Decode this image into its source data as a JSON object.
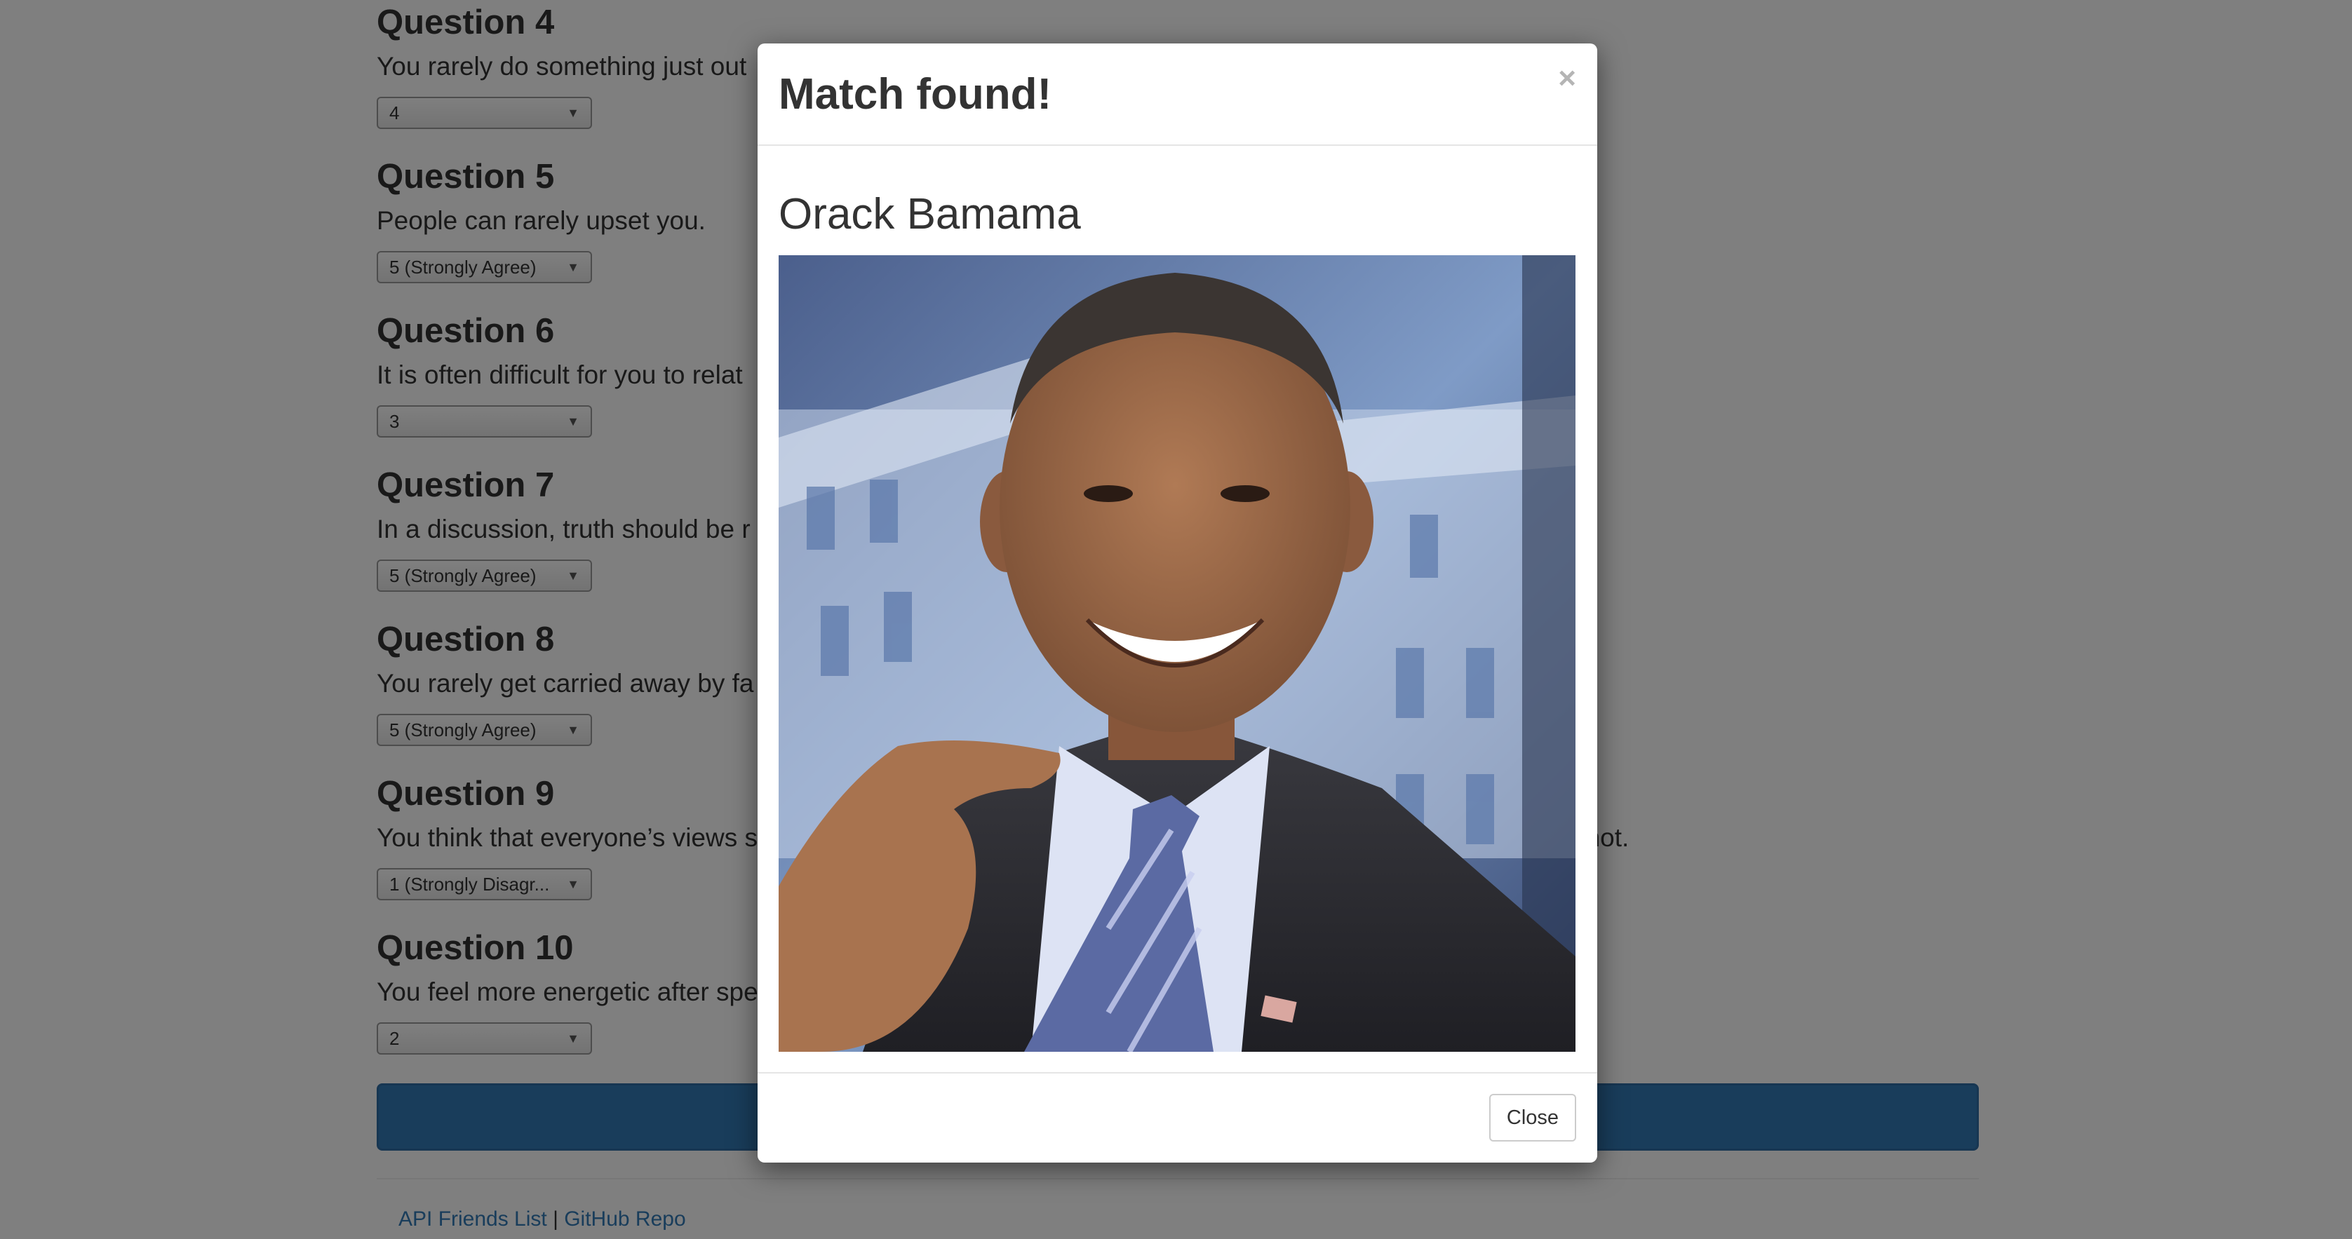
{
  "questions": [
    {
      "title": "Question 4",
      "text": "You rarely do something just out",
      "answer": "4"
    },
    {
      "title": "Question 5",
      "text": "People can rarely upset you.",
      "answer": "5 (Strongly Agree)"
    },
    {
      "title": "Question 6",
      "text": "It is often difficult for you to relat",
      "answer": "3"
    },
    {
      "title": "Question 7",
      "text": "In a discussion, truth should be r",
      "answer": "5 (Strongly Agree)"
    },
    {
      "title": "Question 8",
      "text": "You rarely get carried away by fa",
      "answer": "5 (Strongly Agree)"
    },
    {
      "title": "Question 9",
      "text": "You think that everyone’s views s",
      "answer": "1 (Strongly Disagr...",
      "text_tail": "r not."
    },
    {
      "title": "Question 10",
      "text": "You feel more energetic after spe",
      "answer": "2"
    }
  ],
  "footer": {
    "link1": "API Friends List",
    "separator": " | ",
    "link2": "GitHub Repo"
  },
  "modal": {
    "title": "Match found!",
    "close_icon": "×",
    "match_name": "Orack Bamama",
    "photo_alt": "Photo of the matched person",
    "close_label": "Close"
  },
  "colors": {
    "primary": "#337ab7",
    "backdrop": "rgba(0,0,0,0.5)",
    "link": "#337ab7"
  }
}
